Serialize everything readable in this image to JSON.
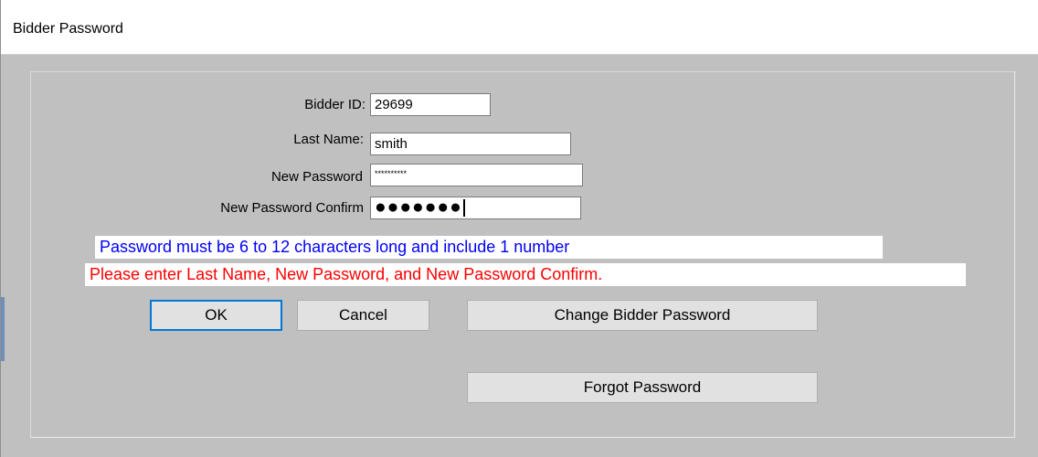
{
  "window": {
    "title": "Bidder Password"
  },
  "form": {
    "bidder_id": {
      "label": "Bidder ID:",
      "value": "29699"
    },
    "last_name": {
      "label": "Last Name:",
      "value": "smith"
    },
    "new_password": {
      "label": "New Password",
      "value": "**********"
    },
    "new_password_confirm": {
      "label": "New Password Confirm",
      "value": "●●●●●●●"
    }
  },
  "messages": {
    "hint": "Password must be 6 to 12 characters long and include 1 number",
    "error": "Please enter Last Name, New Password, and  New Password Confirm.",
    "hint_color": "#0000ff",
    "error_color": "#ff0000"
  },
  "buttons": {
    "ok": "OK",
    "cancel": "Cancel",
    "change": "Change Bidder Password",
    "forgot": "Forgot Password"
  }
}
